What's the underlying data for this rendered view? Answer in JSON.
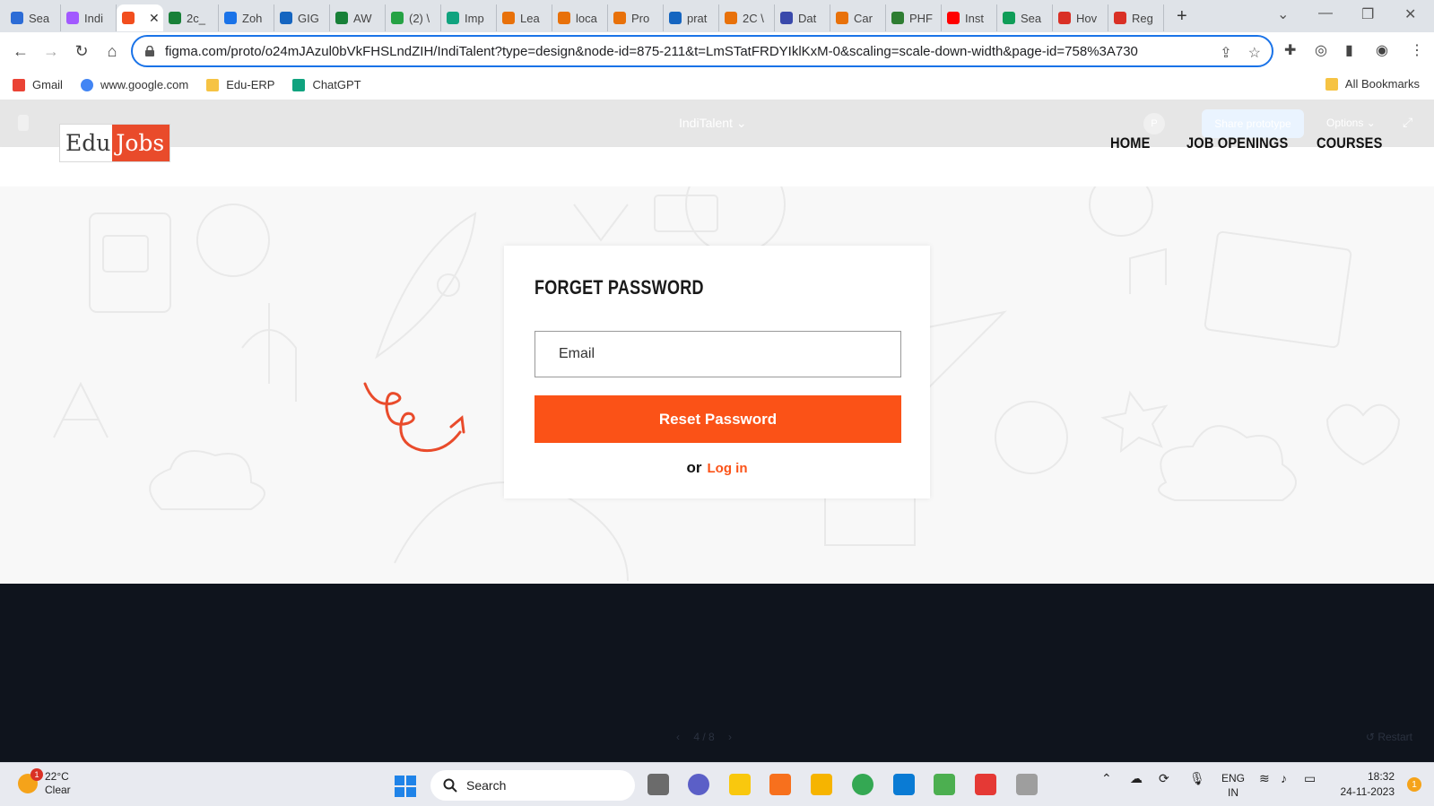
{
  "browser": {
    "tabs": [
      {
        "label": "Sea",
        "color": "#2c6cd6"
      },
      {
        "label": "Indi",
        "color": "#a259ff"
      },
      {
        "label": "",
        "color": "#f24e1e",
        "active": true
      },
      {
        "label": "2c_",
        "color": "#188038"
      },
      {
        "label": "Zoh",
        "color": "#1a73e8"
      },
      {
        "label": "GIG",
        "color": "#1565c0"
      },
      {
        "label": "AW",
        "color": "#188038"
      },
      {
        "label": "(2) \\",
        "color": "#25a244"
      },
      {
        "label": "Imp",
        "color": "#10a37f"
      },
      {
        "label": "Lea",
        "color": "#e8710a"
      },
      {
        "label": "loca",
        "color": "#e8710a"
      },
      {
        "label": "Pro",
        "color": "#e8710a"
      },
      {
        "label": "prat",
        "color": "#1565c0"
      },
      {
        "label": "2C \\",
        "color": "#e8710a"
      },
      {
        "label": "Dat",
        "color": "#3949ab"
      },
      {
        "label": "Car",
        "color": "#e8710a"
      },
      {
        "label": "PHF",
        "color": "#2e7d32"
      },
      {
        "label": "Inst",
        "color": "#ff0000"
      },
      {
        "label": "Sea",
        "color": "#0f9d58"
      },
      {
        "label": "Hov",
        "color": "#d93025"
      },
      {
        "label": "Reg",
        "color": "#d93025"
      }
    ],
    "active_close": "✕",
    "new_tab": "+",
    "url": "figma.com/proto/o24mJAzul0bVkFHSLndZIH/IndiTalent?type=design&node-id=875-211&t=LmSTatFRDYIklKxM-0&scaling=scale-down-width&page-id=758%3A730",
    "bookmarks": [
      "Gmail",
      "www.google.com",
      "Edu-ERP",
      "ChatGPT"
    ],
    "all_bookmarks": "All Bookmarks"
  },
  "figma": {
    "file_title": "IndiTalent",
    "share": "Share prototype",
    "options": "Options",
    "avatar": "P",
    "pager": "4 / 8",
    "restart": "Restart"
  },
  "site": {
    "logo_part1": "Edu",
    "logo_part2": "Jobs",
    "nav": [
      "HOME",
      "JOB OPENINGS",
      "COURSES"
    ],
    "form": {
      "title": "FORGET PASSWORD",
      "email_placeholder": "Email",
      "reset_button": "Reset Password",
      "or_text": "or",
      "login_link": "Log in"
    },
    "accent_color": "#fb5217"
  },
  "taskbar": {
    "weather_temp": "22°C",
    "weather_desc": "Clear",
    "weather_badge": "1",
    "search": "Search",
    "lang1": "ENG",
    "lang2": "IN",
    "time": "18:32",
    "date": "24-11-2023",
    "notif": "1"
  }
}
